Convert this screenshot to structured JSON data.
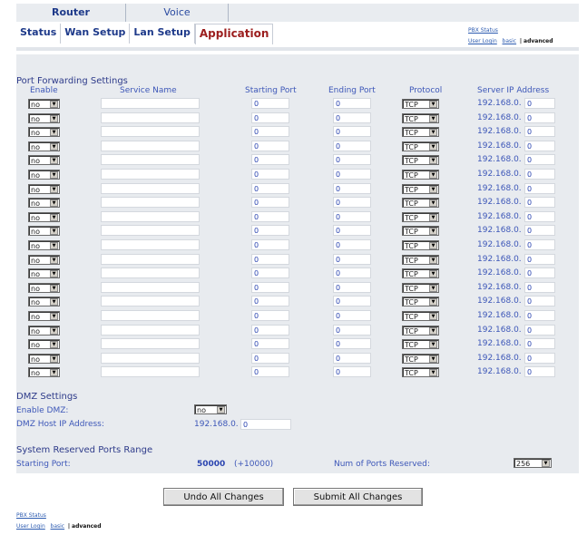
{
  "top_tabs": [
    "Router",
    "Voice"
  ],
  "sub_tabs": [
    "Status",
    "Wan Setup",
    "Lan Setup",
    "Application"
  ],
  "quick_links": {
    "pbx_status": "PBX Status",
    "user_login": "User Login",
    "basic": "basic",
    "separator": "|",
    "advanced": "advanced"
  },
  "port_forwarding": {
    "title": "Port Forwarding Settings",
    "headers": [
      "Enable",
      "Service Name",
      "Starting Port",
      "Ending Port",
      "Protocol",
      "Server IP Address"
    ],
    "ip_prefix": "192.168.0.",
    "rows": [
      {
        "enable": "no",
        "service": "",
        "start": "0",
        "end": "0",
        "protocol": "TCP",
        "ip": "0"
      },
      {
        "enable": "no",
        "service": "",
        "start": "0",
        "end": "0",
        "protocol": "TCP",
        "ip": "0"
      },
      {
        "enable": "no",
        "service": "",
        "start": "0",
        "end": "0",
        "protocol": "TCP",
        "ip": "0"
      },
      {
        "enable": "no",
        "service": "",
        "start": "0",
        "end": "0",
        "protocol": "TCP",
        "ip": "0"
      },
      {
        "enable": "no",
        "service": "",
        "start": "0",
        "end": "0",
        "protocol": "TCP",
        "ip": "0"
      },
      {
        "enable": "no",
        "service": "",
        "start": "0",
        "end": "0",
        "protocol": "TCP",
        "ip": "0"
      },
      {
        "enable": "no",
        "service": "",
        "start": "0",
        "end": "0",
        "protocol": "TCP",
        "ip": "0"
      },
      {
        "enable": "no",
        "service": "",
        "start": "0",
        "end": "0",
        "protocol": "TCP",
        "ip": "0"
      },
      {
        "enable": "no",
        "service": "",
        "start": "0",
        "end": "0",
        "protocol": "TCP",
        "ip": "0"
      },
      {
        "enable": "no",
        "service": "",
        "start": "0",
        "end": "0",
        "protocol": "TCP",
        "ip": "0"
      },
      {
        "enable": "no",
        "service": "",
        "start": "0",
        "end": "0",
        "protocol": "TCP",
        "ip": "0"
      },
      {
        "enable": "no",
        "service": "",
        "start": "0",
        "end": "0",
        "protocol": "TCP",
        "ip": "0"
      },
      {
        "enable": "no",
        "service": "",
        "start": "0",
        "end": "0",
        "protocol": "TCP",
        "ip": "0"
      },
      {
        "enable": "no",
        "service": "",
        "start": "0",
        "end": "0",
        "protocol": "TCP",
        "ip": "0"
      },
      {
        "enable": "no",
        "service": "",
        "start": "0",
        "end": "0",
        "protocol": "TCP",
        "ip": "0"
      },
      {
        "enable": "no",
        "service": "",
        "start": "0",
        "end": "0",
        "protocol": "TCP",
        "ip": "0"
      },
      {
        "enable": "no",
        "service": "",
        "start": "0",
        "end": "0",
        "protocol": "TCP",
        "ip": "0"
      },
      {
        "enable": "no",
        "service": "",
        "start": "0",
        "end": "0",
        "protocol": "TCP",
        "ip": "0"
      },
      {
        "enable": "no",
        "service": "",
        "start": "0",
        "end": "0",
        "protocol": "TCP",
        "ip": "0"
      },
      {
        "enable": "no",
        "service": "",
        "start": "0",
        "end": "0",
        "protocol": "TCP",
        "ip": "0"
      }
    ]
  },
  "dmz": {
    "title": "DMZ Settings",
    "enable_label": "Enable DMZ:",
    "enable_value": "no",
    "host_label": "DMZ Host IP Address:",
    "host_prefix": "192.168.0.",
    "host_value": "0"
  },
  "reserved": {
    "title": "System Reserved Ports Range",
    "start_label": "Starting Port:",
    "start_value": "50000",
    "range_note": "(+10000)",
    "num_label": "Num of Ports Reserved:",
    "num_value": "256"
  },
  "buttons": {
    "undo": "Undo All Changes",
    "submit": "Submit All Changes"
  },
  "colors": {
    "link": "#2c5bb0",
    "label": "#3d57b8",
    "panel_bg": "#e8ebef",
    "active_tab": "#9b1d1d"
  },
  "icons": {
    "dropdown": "dropdown-arrow-icon"
  }
}
